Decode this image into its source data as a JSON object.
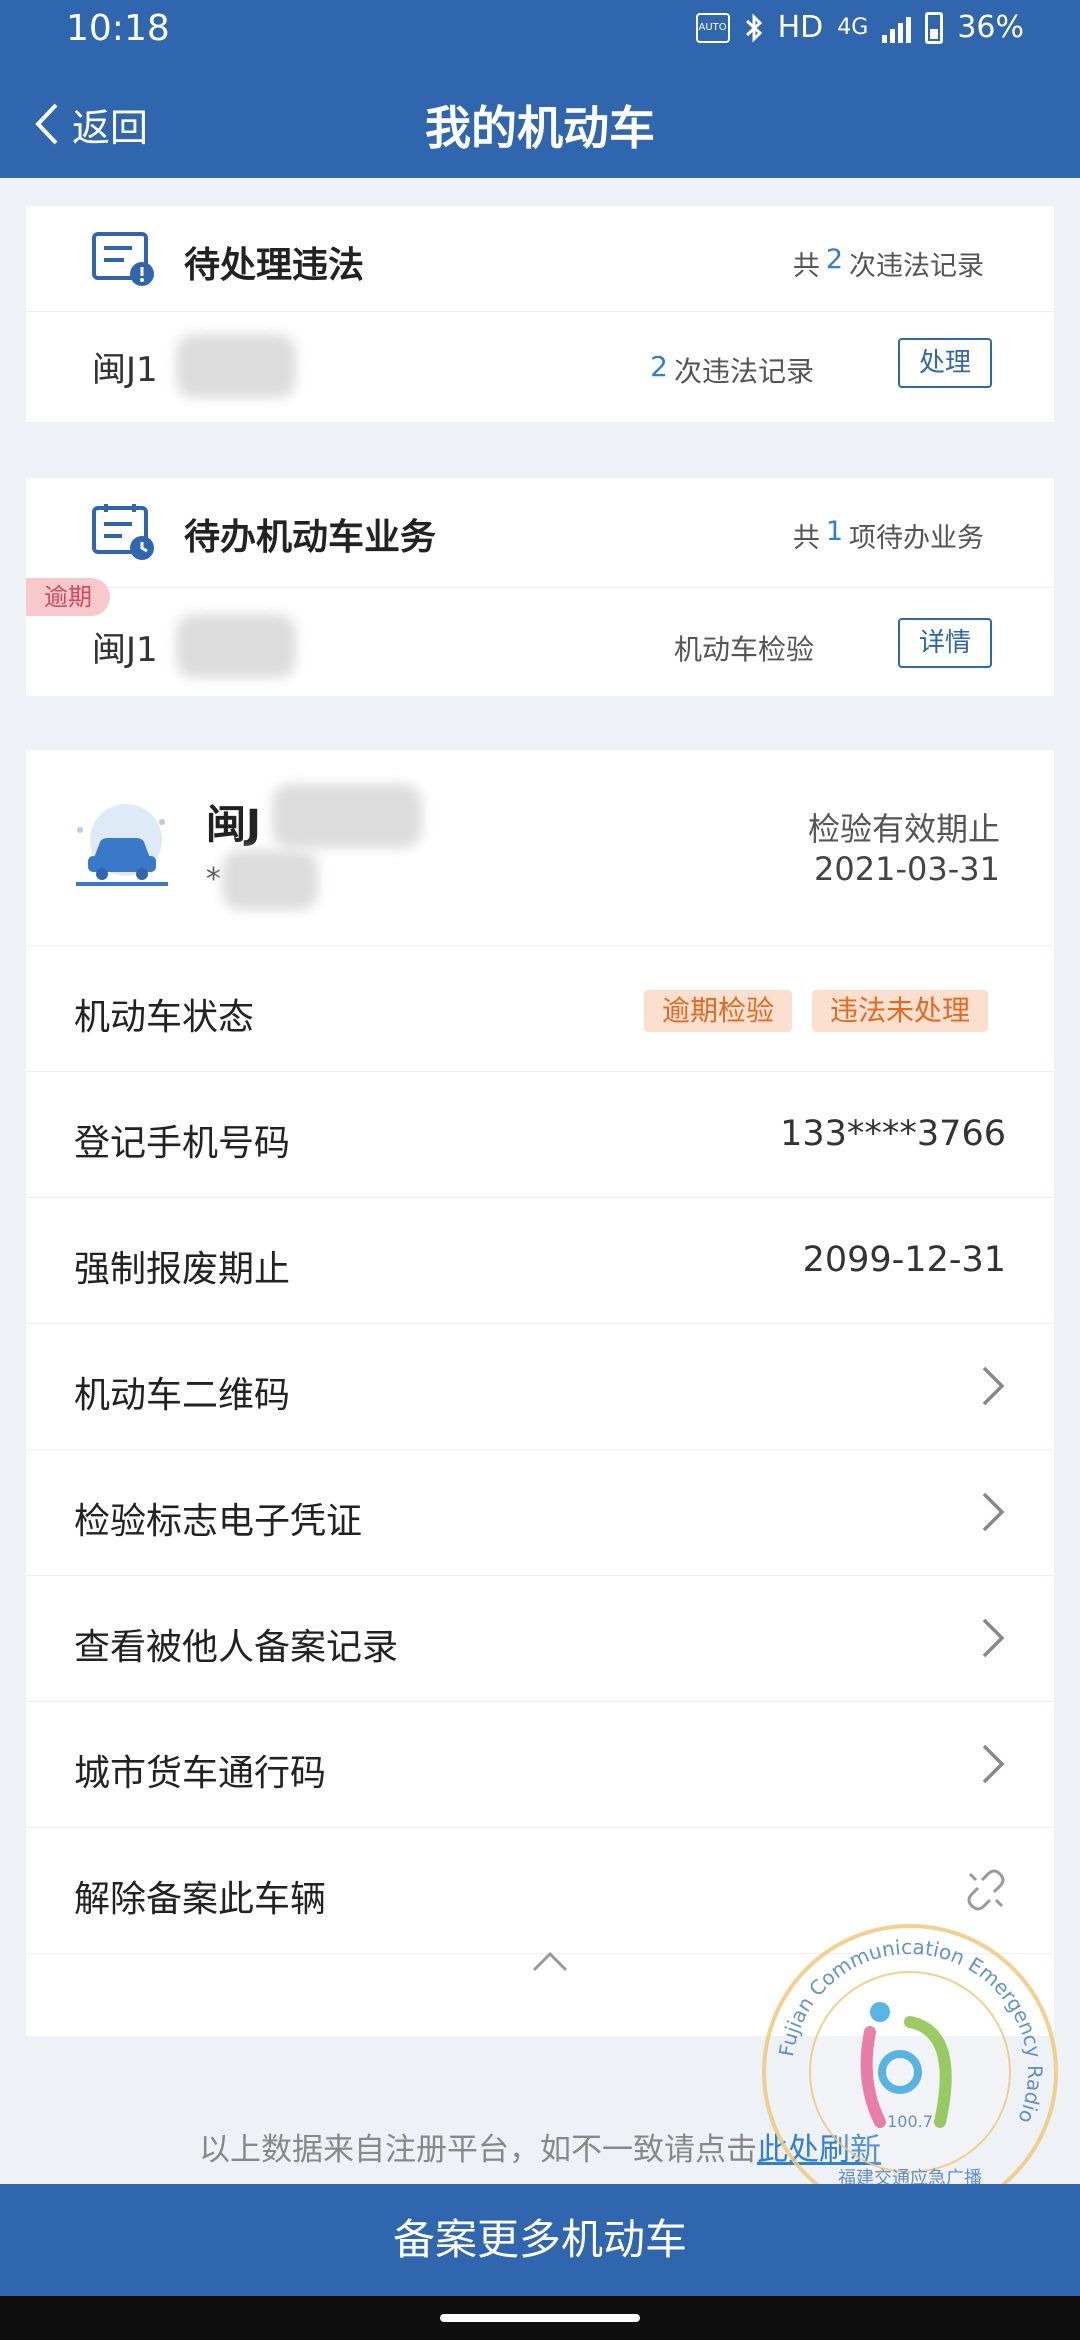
{
  "status_bar": {
    "time": "10:18",
    "auto_badge": "AUTO",
    "hd": "HD",
    "network": "4G",
    "battery": "36%"
  },
  "nav": {
    "back_label": "返回",
    "title": "我的机动车"
  },
  "violations_card": {
    "title": "待处理违法",
    "summary_prefix": "共",
    "summary_count": "2",
    "summary_suffix": "次违法记录",
    "row": {
      "plate": "闽J1",
      "count": "2",
      "count_suffix": "次违法记录",
      "button": "处理"
    }
  },
  "business_card": {
    "title": "待办机动车业务",
    "summary_prefix": "共",
    "summary_count": "1",
    "summary_suffix": "项待办业务",
    "row": {
      "tag": "逾期",
      "plate": "闽J1",
      "item": "机动车检验",
      "button": "详情"
    }
  },
  "vehicle": {
    "plate": "闽J",
    "sub": "*",
    "expiry_label": "检验有效期止",
    "expiry_date": "2021-03-31",
    "rows": [
      {
        "label": "机动车状态",
        "tags": [
          "逾期检验",
          "违法未处理"
        ]
      },
      {
        "label": "登记手机号码",
        "value": "133****3766"
      },
      {
        "label": "强制报废期止",
        "value": "2099-12-31"
      },
      {
        "label": "机动车二维码"
      },
      {
        "label": "检验标志电子凭证"
      },
      {
        "label": "查看被他人备案记录"
      },
      {
        "label": "城市货车通行码"
      },
      {
        "label": "解除备案此车辆"
      }
    ]
  },
  "footer": {
    "note": "以上数据来自注册平台，如不一致请点击",
    "link": "此处刷新"
  },
  "bottom_button": "备案更多机动车",
  "watermark": {
    "ring_text": "Fujian Communication Emergency Radio",
    "freq": "100.7",
    "cn_text": "福建交通应急广播"
  },
  "colors": {
    "primary": "#2f66ad",
    "accent_blue": "#2f7fd6",
    "warning_tag_bg": "#fce0cf",
    "warning_tag_text": "#e36a24",
    "overdue_tag_bg": "#f7c9cd"
  }
}
